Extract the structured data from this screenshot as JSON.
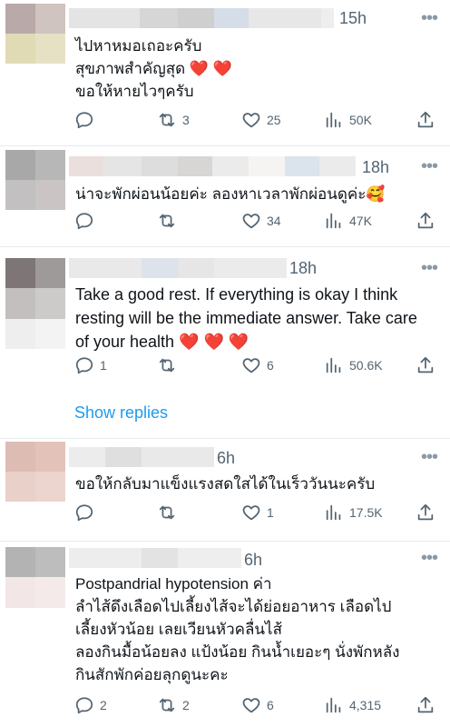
{
  "tweets": [
    {
      "time": "15h",
      "text": "ไปหาหมอเถอะครับ\nสุขภาพสำคัญสุด ❤️ ❤️\nขอให้หายไวๆครับ",
      "replies": "",
      "retweets": "3",
      "likes": "25",
      "views": "50K"
    },
    {
      "time": "18h",
      "text": "น่าจะพักผ่อนน้อยค่ะ ลองหาเวลาพักผ่อนดูค่ะ🥰",
      "replies": "",
      "retweets": "",
      "likes": "34",
      "views": "47K"
    },
    {
      "time": "18h",
      "text": "Take a good rest. If everything is okay I think resting will be the immediate answer. Take care of your health ❤️ ❤️ ❤️",
      "replies": "1",
      "retweets": "",
      "likes": "6",
      "views": "50.6K",
      "show_replies": "Show replies"
    },
    {
      "time": "6h",
      "text": "ขอให้กลับมาแข็งแรงสดใสได้ในเร็ววันนะครับ",
      "replies": "",
      "retweets": "",
      "likes": "1",
      "views": "17.5K"
    },
    {
      "time": "6h",
      "text": "Postpandrial hypotension ค่า\nลำไส้ดึงเลือดไปเลี้ยงไส้จะได้ย่อยอาหาร เลือดไป\nเลี้ยงหัวน้อย เลยเวียนหัวคลื่นไส้\nลองกินมื้อน้อยลง แป้งน้อย กินน้ำเยอะๆ นั่งพักหลัง\nกินสักพักค่อยลุกดูนะคะ",
      "replies": "2",
      "retweets": "2",
      "likes": "6",
      "views": "4,315"
    }
  ],
  "icons": {
    "reply": "reply-icon",
    "retweet": "retweet-icon",
    "like": "heart-icon",
    "views": "views-icon",
    "share": "share-icon",
    "more": "more-icon"
  }
}
